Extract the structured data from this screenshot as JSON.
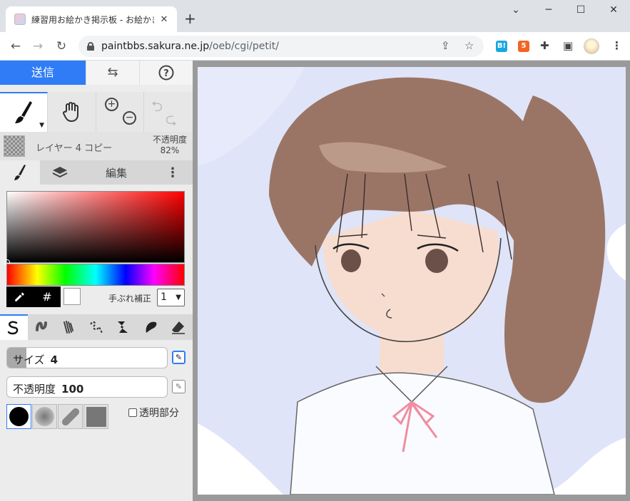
{
  "browser": {
    "tab_title": "練習用お絵かき掲示板 - お絵かき掲",
    "url_host": "paintbbs.sakura.ne.jp",
    "url_path": "/oeb/cgi/petit/",
    "ext_b_label": "B!"
  },
  "app": {
    "send_label": "送信",
    "layer_name": "レイヤー 4 コピー",
    "opacity_title": "不透明度",
    "opacity_value": "82%",
    "edit_tab_label": "編集",
    "hash_label": "#",
    "stabilizer_label": "手ぶれ補正",
    "stabilizer_value": "1",
    "size_label": "サイズ",
    "size_value": "4",
    "size_fill": 0.12,
    "opacity_slider_label": "不透明度",
    "opacity_slider_value": "100",
    "transparent_label": "透明部分"
  },
  "colors": {
    "accent": "#2f7cf6",
    "hair": "#9a7566",
    "sky": "#dfe4f8",
    "skin": "#f7ddd0",
    "ribbon": "#f08da0"
  },
  "icons": [
    "brush-icon",
    "hand-icon",
    "zoom-in-icon",
    "zoom-out-icon",
    "undo-icon",
    "redo-icon",
    "layers-icon",
    "more-icon",
    "eyedropper-icon",
    "pen-icon",
    "eraser-icon"
  ]
}
